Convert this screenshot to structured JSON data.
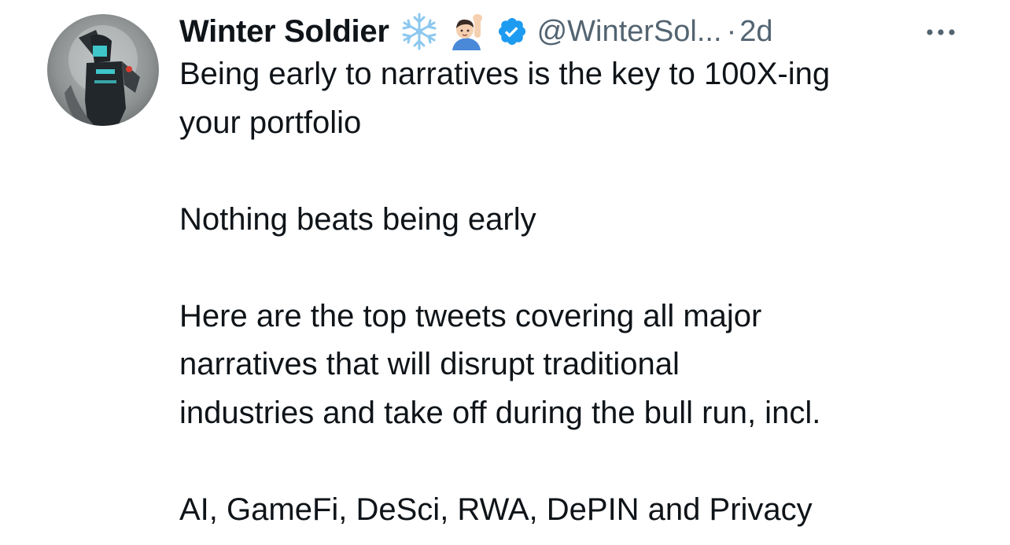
{
  "tweet": {
    "author": {
      "display_name": "Winter Soldier",
      "emojis": [
        "snowflake-emoji",
        "person-raising-hand-emoji"
      ],
      "verified": true,
      "handle": "@WinterSol...",
      "separator": "·",
      "timestamp": "2d"
    },
    "more_icon": "more-horizontal-icon",
    "body": {
      "p1_line1": "Being early to narratives is the key to 100X-ing",
      "p1_line2": "your portfolio",
      "p2_line1": "Nothing beats being early",
      "p3_line1": "Here are the top tweets covering all major",
      "p3_line2": "narratives that will disrupt traditional",
      "p3_line3": "industries and take off during the bull run, incl.",
      "p4_line1": "AI, GameFi, DeSci, RWA, DePIN and Privacy"
    },
    "colors": {
      "text": "#0f1419",
      "secondary": "#536471",
      "verified": "#1d9bf0"
    }
  }
}
